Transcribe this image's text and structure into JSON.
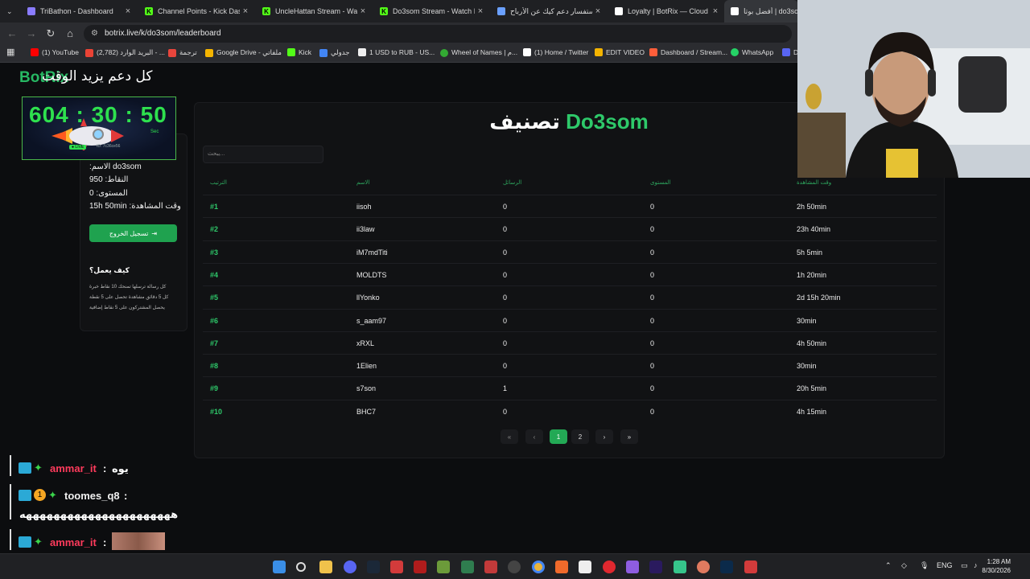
{
  "browser": {
    "tabs": [
      {
        "title": "TriBathon - Dashboard",
        "icon": "tribathon-icon",
        "color": "#8a7cff"
      },
      {
        "title": "Channel Points - Kick Dashbo",
        "icon": "kick-icon",
        "color": "#53fc18"
      },
      {
        "title": "UncleHattan Stream - Watch L",
        "icon": "kick-icon",
        "color": "#53fc18"
      },
      {
        "title": "Do3som Stream - Watch Li",
        "icon": "kick-icon",
        "color": "#53fc18"
      },
      {
        "title": "استفسار دعم كيك عن الأرباح",
        "icon": "gemini-icon",
        "color": "#6aa0ff"
      },
      {
        "title": "Loyalty | BotRix — Cloud St",
        "icon": "botrix-icon",
        "color": "#ffffff"
      },
      {
        "title": "أفضل بوتا | do3som",
        "icon": "botrix-icon",
        "color": "#ffffff"
      }
    ],
    "url": "botrix.live/k/do3som/leaderboard",
    "bookmarks": [
      {
        "label": "(1) YouTube",
        "color": "#ff0000"
      },
      {
        "label": "(2,782) البريد الوارد - ...",
        "color": "#ea4335"
      },
      {
        "label": "ترجمة",
        "color": "#e8453c"
      },
      {
        "label": "Google Drive - ملفاتي",
        "color": "#f4b400"
      },
      {
        "label": "Kick",
        "color": "#53fc18"
      },
      {
        "label": "جدولي",
        "color": "#4285f4"
      },
      {
        "label": "1 USD to RUB - US...",
        "color": "#eeeeee"
      },
      {
        "label": "Wheel of Names | م...",
        "color": "#33aa33"
      },
      {
        "label": "(1) Home / Twitter",
        "color": "#ffffff"
      },
      {
        "label": "EDIT VIDEO",
        "color": "#f4b400"
      },
      {
        "label": "Dashboard / Stream...",
        "color": "#ff5e3a"
      },
      {
        "label": "WhatsApp",
        "color": "#25d366"
      },
      {
        "label": "D",
        "color": "#5865f2"
      }
    ]
  },
  "page": {
    "brand": "BotRix",
    "banner": "كل دعم يزيد الوقت",
    "title_name": "Do3som",
    "title_word": "تصنيف",
    "search_placeholder": "يبحث...",
    "timer": {
      "text": "604 : 30 : 50",
      "sec_label": "Sec",
      "id_text": "ID: 7c36ce56",
      "live": "● LIVE"
    },
    "profile": {
      "name_label": ":الاسم",
      "name_value": "do3som",
      "points_label": ":النقاط",
      "points_value": "950",
      "level_label": ":المستوى",
      "level_value": "0",
      "watch_label": ":وقت المشاهدة",
      "watch_value": "15h 50min",
      "logout": "تسجيل الخروج"
    },
    "how": {
      "title": "كيف يعمل؟",
      "lines": [
        "كل رسالة ترسلها تمنحك 10 نقاط خبرة",
        "كل 5 دقائق مشاهدة تحصل على 5 نقطة",
        "يحصل المشتركون على 5 نقاط إضافية"
      ]
    },
    "table": {
      "headers": [
        "الترتيب",
        "الاسم",
        "الرسائل",
        "المستوى",
        "وقت المشاهدة"
      ],
      "rows": [
        [
          "#1",
          "iisoh",
          "0",
          "0",
          "2h 50min"
        ],
        [
          "#2",
          "ii3law",
          "0",
          "0",
          "23h 40min"
        ],
        [
          "#3",
          "iM7mdTiti",
          "0",
          "0",
          "5h 5min"
        ],
        [
          "#4",
          "MOLDTS",
          "0",
          "0",
          "1h 20min"
        ],
        [
          "#5",
          "llYonko",
          "0",
          "0",
          "2d 15h 20min"
        ],
        [
          "#6",
          "s_aam97",
          "0",
          "0",
          "30min"
        ],
        [
          "#7",
          "xRXL",
          "0",
          "0",
          "4h 50min"
        ],
        [
          "#8",
          "1Elien",
          "0",
          "0",
          "30min"
        ],
        [
          "#9",
          "s7son",
          "1",
          "0",
          "20h 5min"
        ],
        [
          "#10",
          "BHC7",
          "0",
          "0",
          "4h 15min"
        ]
      ]
    },
    "pagination": {
      "first": "«",
      "prev": "‹",
      "pages": [
        "1",
        "2"
      ],
      "current": "1",
      "next": "›",
      "last": "»"
    }
  },
  "chat": [
    {
      "user": "ammar_it",
      "sep": ":",
      "msg": "يوه",
      "color": "#ff3b5c"
    },
    {
      "user": "toomes_q8",
      "sep": ":",
      "msg": "ههههههههههههههههههههههه",
      "color": "#f0f0f0"
    },
    {
      "user": "ammar_it",
      "sep": ":",
      "msg": "",
      "color": "#ff3b5c"
    }
  ],
  "taskbar": {
    "lang": "ENG",
    "time": "1:28 AM",
    "date": "8/30/2026"
  }
}
